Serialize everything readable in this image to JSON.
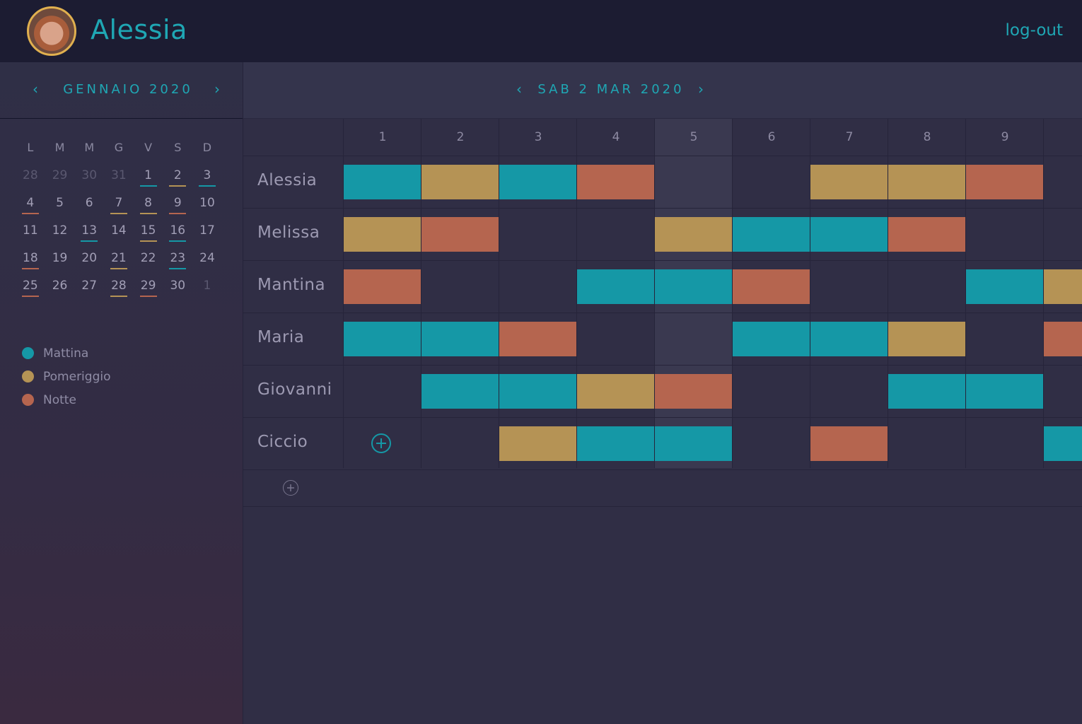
{
  "header": {
    "username": "Alessia",
    "logout_label": "log-out"
  },
  "colors": {
    "mattina": "#1598a6",
    "pomeriggio": "#b59355",
    "notte": "#b5654f",
    "accent": "#1fa7b4"
  },
  "sidebar": {
    "prev_icon": "chevron-left-icon",
    "next_icon": "chevron-right-icon",
    "month_label": "GENNAIO 2020",
    "weekday_headers": [
      "L",
      "M",
      "M",
      "G",
      "V",
      "S",
      "D"
    ],
    "weeks": [
      [
        {
          "d": "28",
          "m": true
        },
        {
          "d": "29",
          "m": true
        },
        {
          "d": "30",
          "m": true
        },
        {
          "d": "31",
          "m": true
        },
        {
          "d": "1",
          "s": "mattina"
        },
        {
          "d": "2",
          "s": "pomeriggio"
        },
        {
          "d": "3",
          "s": "mattina"
        }
      ],
      [
        {
          "d": "4",
          "s": "notte"
        },
        {
          "d": "5"
        },
        {
          "d": "6"
        },
        {
          "d": "7",
          "s": "pomeriggio"
        },
        {
          "d": "8",
          "s": "pomeriggio"
        },
        {
          "d": "9",
          "s": "notte"
        },
        {
          "d": "10"
        }
      ],
      [
        {
          "d": "11"
        },
        {
          "d": "12"
        },
        {
          "d": "13",
          "s": "mattina"
        },
        {
          "d": "14"
        },
        {
          "d": "15",
          "s": "pomeriggio"
        },
        {
          "d": "16",
          "s": "mattina"
        },
        {
          "d": "17"
        }
      ],
      [
        {
          "d": "18",
          "s": "notte"
        },
        {
          "d": "19"
        },
        {
          "d": "20"
        },
        {
          "d": "21",
          "s": "pomeriggio"
        },
        {
          "d": "22"
        },
        {
          "d": "23",
          "s": "mattina"
        },
        {
          "d": "24"
        }
      ],
      [
        {
          "d": "25",
          "s": "notte"
        },
        {
          "d": "26"
        },
        {
          "d": "27"
        },
        {
          "d": "28",
          "s": "pomeriggio"
        },
        {
          "d": "29",
          "s": "notte"
        },
        {
          "d": "30"
        },
        {
          "d": "1",
          "m": true
        }
      ]
    ],
    "legend": [
      {
        "label": "Mattina",
        "shift": "mattina"
      },
      {
        "label": "Pomeriggio",
        "shift": "pomeriggio"
      },
      {
        "label": "Notte",
        "shift": "notte"
      }
    ]
  },
  "main": {
    "date_label": "SAB 2 MAR 2020",
    "columns": [
      "1",
      "2",
      "3",
      "4",
      "5",
      "6",
      "7",
      "8",
      "9"
    ],
    "today_column": "5",
    "rows": [
      {
        "name": "Alessia",
        "shifts": [
          "mattina",
          "pomeriggio",
          "mattina",
          "notte",
          null,
          null,
          "pomeriggio",
          "pomeriggio",
          "notte",
          null
        ]
      },
      {
        "name": "Melissa",
        "shifts": [
          "pomeriggio",
          "notte",
          null,
          null,
          "pomeriggio",
          "mattina",
          "mattina",
          "notte",
          null,
          null
        ]
      },
      {
        "name": "Mantina",
        "shifts": [
          "notte",
          null,
          null,
          "mattina",
          "mattina",
          "notte",
          null,
          null,
          "mattina",
          "pomeriggio"
        ]
      },
      {
        "name": "Maria",
        "shifts": [
          "mattina",
          "mattina",
          "notte",
          null,
          null,
          "mattina",
          "mattina",
          "pomeriggio",
          null,
          "notte"
        ]
      },
      {
        "name": "Giovanni",
        "shifts": [
          null,
          "mattina",
          "mattina",
          "pomeriggio",
          "notte",
          null,
          null,
          "mattina",
          "mattina",
          null
        ]
      },
      {
        "name": "Ciccio",
        "shifts": [
          "add",
          "notte_skip",
          null,
          null,
          null,
          null,
          null,
          null,
          null,
          "mattina"
        ]
      }
    ],
    "ciccio_shifts": [
      null,
      null,
      "pomeriggio",
      "mattina",
      "mattina",
      null,
      "notte",
      null,
      null,
      "mattina"
    ],
    "add_row_icon": "add-circle-icon"
  }
}
